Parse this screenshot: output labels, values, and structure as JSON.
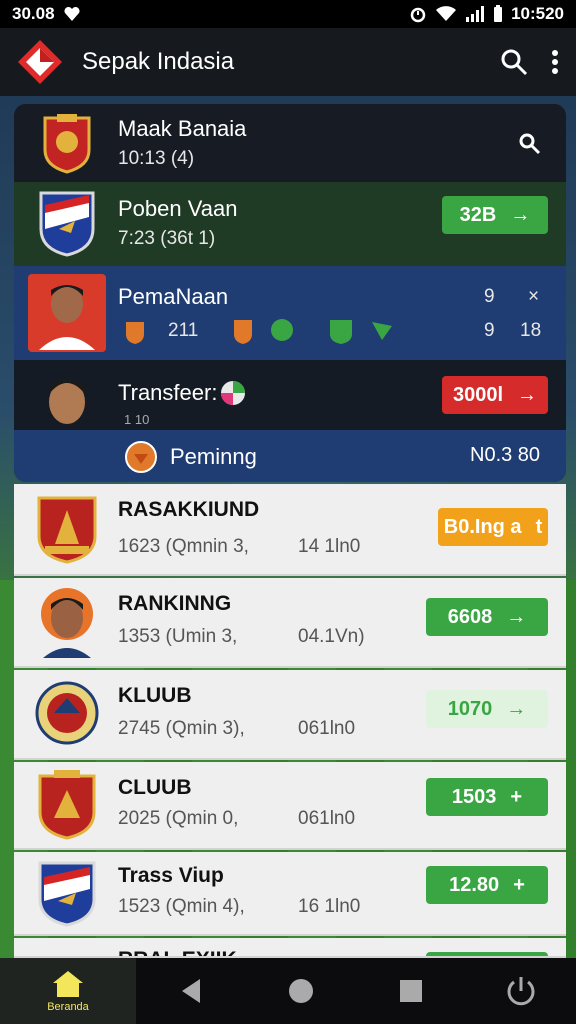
{
  "status_bar": {
    "time_left": "30.08",
    "time_right": "10:520"
  },
  "app_bar": {
    "title": "Sepak Indasia",
    "search_icon": "search-icon",
    "more_icon": "more-vert-icon"
  },
  "featured": {
    "row1": {
      "title": "Maak Banaia",
      "sub": "10:13 (4)"
    },
    "row2": {
      "title": "Poben Vaan",
      "sub": "7:23  (36t 1)",
      "button_value": "32B",
      "button_arrow": "→"
    },
    "row3": {
      "title": "PemaNaan",
      "stat": "211",
      "right_top_1": "9",
      "right_top_2": "×",
      "right_bottom_1": "9",
      "right_bottom_2": "18"
    },
    "row4": {
      "title": "Transfeer:",
      "small_text": "1 10",
      "button_value": "3000l",
      "button_arrow": "→"
    },
    "row5": {
      "label": "Peminng",
      "value": "N0.3 80"
    }
  },
  "list": [
    {
      "title": "RASAKKIUND",
      "sub": "1623 (Qmnin 3,",
      "extra": "14 1ln0",
      "button_value": "B0.Ing a",
      "button_arrow": "t",
      "button_style": "orange"
    },
    {
      "title": "RANKINNG",
      "sub": "1353 (Umin 3,",
      "extra": "04.1Vn)",
      "button_value": "6608",
      "button_arrow": "→",
      "button_style": "green"
    },
    {
      "title": "KLUUB",
      "sub": "2745 (Qmin 3),",
      "extra": "061ln0",
      "button_value": "1070",
      "button_arrow": "→",
      "button_style": "light"
    },
    {
      "title": "CLUUB",
      "sub": "2025 (Qmin 0,",
      "extra": "061ln0",
      "button_value": "1503",
      "button_arrow": "+",
      "button_style": "green"
    },
    {
      "title": "Trass Viup",
      "sub": "1523 (Qmin 4),",
      "extra": "16 1ln0",
      "button_value": "12.80",
      "button_arrow": "+",
      "button_style": "green"
    },
    {
      "title": "RRAL EXIIK",
      "sub": "",
      "extra": "",
      "button_value": "",
      "button_arrow": "",
      "button_style": "green"
    }
  ],
  "nav": {
    "home_label": "Beranda",
    "back_icon": "back-icon",
    "home_circle_icon": "home-circle-icon",
    "recents_icon": "recents-icon",
    "power_icon": "power-icon"
  }
}
